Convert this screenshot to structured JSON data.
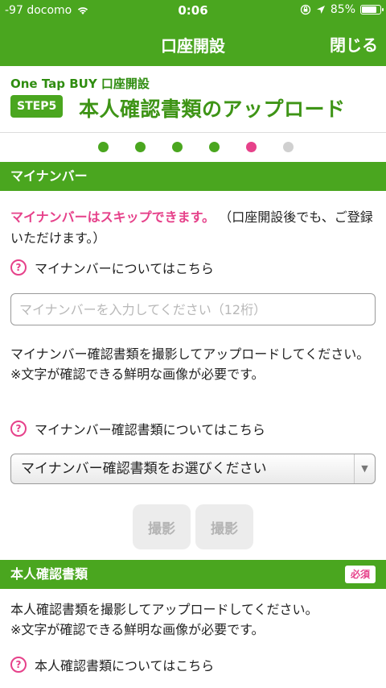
{
  "status": {
    "carrier": "-97 docomo",
    "time": "0:06",
    "battery": "85%",
    "battery_level": 0.85
  },
  "nav": {
    "title": "口座開設",
    "close_label": "閉じる"
  },
  "header": {
    "subtitle": "One Tap BUY 口座開設",
    "step_badge": "STEP5",
    "step_title": "本人確認書類のアップロード"
  },
  "progress": {
    "total_steps": 6,
    "current_step": 5,
    "done_color": "#4aa61f",
    "current_color": "#e6418a",
    "todo_color": "#d0d0d0"
  },
  "mynumber": {
    "section_title": "マイナンバー",
    "skip_notice": "マイナンバーはスキップできます。",
    "skip_notice_rest": "（口座開設後でも、ご登録いただけます。）",
    "help_link": "マイナンバーについてはこちら",
    "input_placeholder": "マイナンバーを入力してください（12桁）",
    "upload_instruction": "マイナンバー確認書類を撮影してアップロードしてください。",
    "clarity_note": "※文字が確認できる鮮明な画像が必要です。",
    "doc_help_link": "マイナンバー確認書類についてはこちら",
    "doc_select_value": "マイナンバー確認書類をお選びください",
    "shoot_button_1": "撮影",
    "shoot_button_2": "撮影"
  },
  "identity": {
    "section_title": "本人確認書類",
    "required_badge": "必須",
    "upload_instruction": "本人確認書類を撮影してアップロードしてください。",
    "clarity_note": "※文字が確認できる鮮明な画像が必要です。",
    "help_link": "本人確認書類についてはこちら"
  },
  "icons": {
    "help": "?",
    "select_arrow": "▼"
  },
  "colors": {
    "brand_green": "#4aa61f",
    "accent_pink": "#e6418a"
  }
}
